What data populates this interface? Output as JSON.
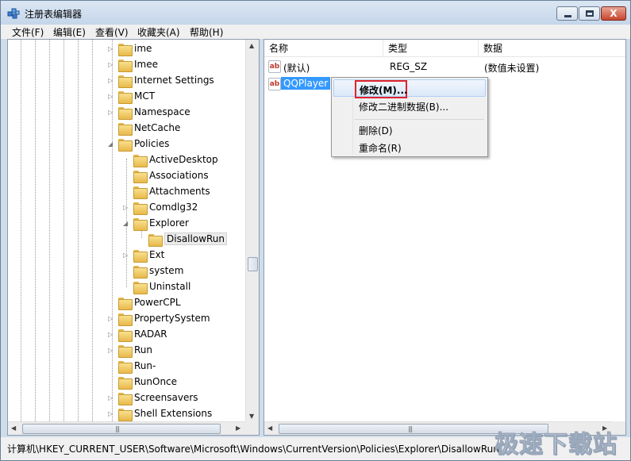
{
  "window": {
    "title": "注册表编辑器",
    "controls": {
      "minimize": "",
      "maximize": "",
      "close": "X"
    }
  },
  "menubar": {
    "items": [
      "文件(F)",
      "编辑(E)",
      "查看(V)",
      "收藏夹(A)",
      "帮助(H)"
    ]
  },
  "tree": {
    "nodes": [
      {
        "label": "ime",
        "expander": "▷"
      },
      {
        "label": "Imee",
        "expander": "▷"
      },
      {
        "label": "Internet Settings",
        "expander": "▷"
      },
      {
        "label": "MCT",
        "expander": "▷"
      },
      {
        "label": "Namespace",
        "expander": "▷"
      },
      {
        "label": "NetCache",
        "expander": ""
      },
      {
        "label": "Policies",
        "expander": "◢"
      },
      {
        "label": "ActiveDesktop",
        "expander": ""
      },
      {
        "label": "Associations",
        "expander": ""
      },
      {
        "label": "Attachments",
        "expander": ""
      },
      {
        "label": "Comdlg32",
        "expander": "▷"
      },
      {
        "label": "Explorer",
        "expander": "◢"
      },
      {
        "label": "DisallowRun",
        "expander": ""
      },
      {
        "label": "Ext",
        "expander": "▷"
      },
      {
        "label": "system",
        "expander": ""
      },
      {
        "label": "Uninstall",
        "expander": ""
      },
      {
        "label": "PowerCPL",
        "expander": ""
      },
      {
        "label": "PropertySystem",
        "expander": "▷"
      },
      {
        "label": "RADAR",
        "expander": "▷"
      },
      {
        "label": "Run",
        "expander": "▷"
      },
      {
        "label": "Run-",
        "expander": ""
      },
      {
        "label": "RunOnce",
        "expander": ""
      },
      {
        "label": "Screensavers",
        "expander": "▷"
      },
      {
        "label": "Shell Extensions",
        "expander": "▷"
      }
    ],
    "selected": "DisallowRun"
  },
  "list": {
    "columns": [
      "名称",
      "类型",
      "数据"
    ],
    "rows": [
      {
        "icon": "ab",
        "name": "(默认)",
        "type": "REG_SZ",
        "data": "(数值未设置)"
      },
      {
        "icon": "ab",
        "name": "QQPlayer",
        "type": "",
        "data": ""
      }
    ]
  },
  "context_menu": {
    "items": [
      "修改(M)...",
      "修改二进制数据(B)...",
      "删除(D)",
      "重命名(R)"
    ],
    "highlighted": "修改(M)..."
  },
  "scrollbars": {
    "up": "▲",
    "down": "▼",
    "left": "◀",
    "right": "▶",
    "grip": "|||"
  },
  "statusbar": {
    "path": "计算机\\HKEY_CURRENT_USER\\Software\\Microsoft\\Windows\\CurrentVersion\\Policies\\Explorer\\DisallowRun"
  },
  "watermark": "极速下载站",
  "colors": {
    "selection": "#3399ff",
    "highlight_box": "#e0242b",
    "folder": "#e8b94a"
  }
}
